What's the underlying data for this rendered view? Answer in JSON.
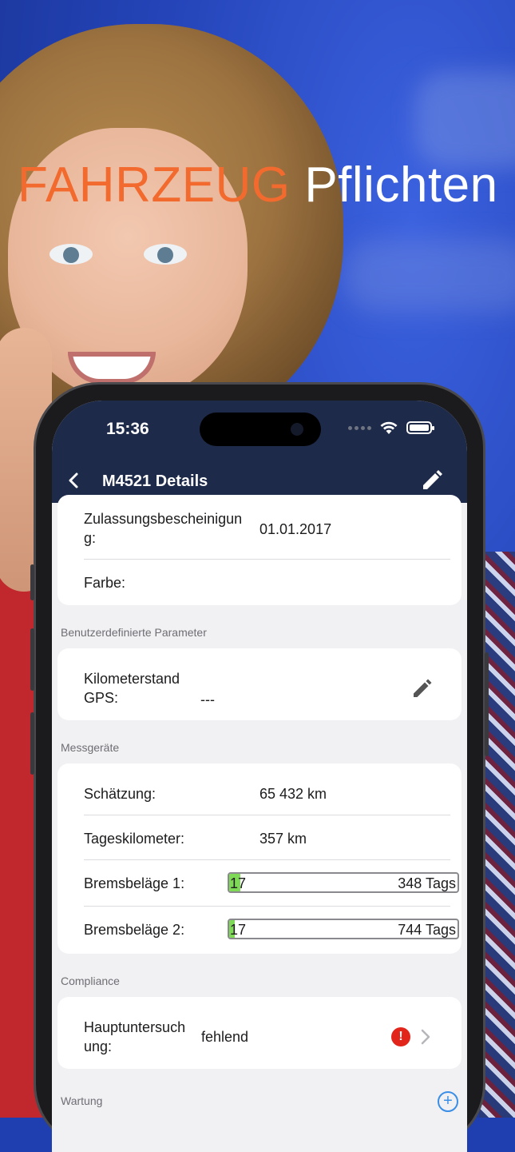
{
  "headline": {
    "word1": "FAHRZEUG",
    "word2": "Pflichten"
  },
  "status_bar": {
    "time": "15:36"
  },
  "nav": {
    "title": "M4521 Details"
  },
  "vehicle_card": {
    "rows": [
      {
        "label_line1": "Zulassungsbescheinigun",
        "label_line2": "g:",
        "value": "01.01.2017"
      },
      {
        "label": "Farbe:",
        "value": ""
      }
    ]
  },
  "custom_params": {
    "section_label": "Benutzerdefinierte Parameter",
    "row": {
      "label_line1": "Kilometerstand",
      "label_line2": "GPS:",
      "value": "---"
    }
  },
  "meters": {
    "section_label": "Messgeräte",
    "estimate": {
      "label": "Schätzung:",
      "value": "65 432 km"
    },
    "daily": {
      "label": "Tageskilometer:",
      "value": "357 km"
    },
    "brake1": {
      "label": "Bremsbeläge 1:",
      "start": "17",
      "end": "348 Tags",
      "progress_fraction": 0.05
    },
    "brake2": {
      "label": "Bremsbeläge 2:",
      "start": "17",
      "end": "744 Tags",
      "progress_fraction": 0.025
    }
  },
  "compliance": {
    "section_label": "Compliance",
    "row": {
      "label_line1": "Hauptuntersuch",
      "label_line2": "ung:",
      "value": "fehlend",
      "alert": "!"
    }
  },
  "maintenance": {
    "section_label": "Wartung",
    "add": "+"
  },
  "icons": {
    "back": "chevron-left-icon",
    "edit": "pencil-icon",
    "row_edit": "pencil-icon",
    "alert": "exclamation-icon",
    "disclosure": "chevron-right-icon",
    "add": "plus-circle-icon"
  },
  "colors": {
    "accent_orange": "#f26a2e",
    "nav_bar": "#1e2a4a",
    "progress_green": "#7ed957",
    "alert_red": "#e1251b",
    "add_blue": "#3a8ee6"
  }
}
